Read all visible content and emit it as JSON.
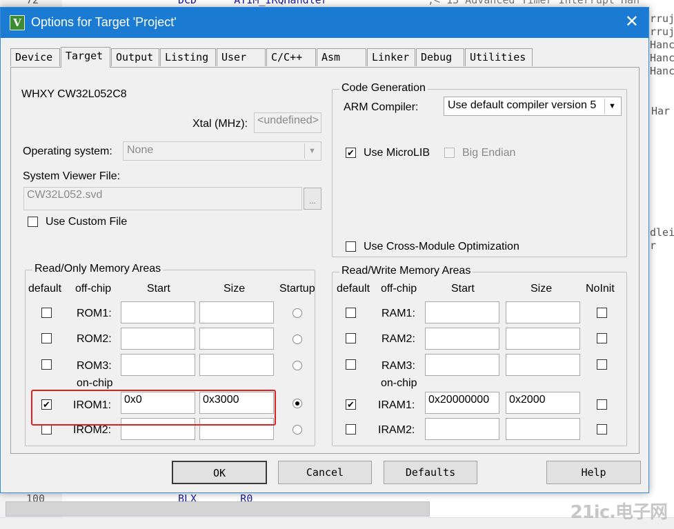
{
  "editor": {
    "top_line_num": "72",
    "top_line_code": "DCD      ATIM_IRQHandler",
    "top_line_comment": ";< 13 Advanced Timer Interrupt Han",
    "right_fragments": [
      "rruj",
      "rruj",
      "Hanc",
      "Hanc",
      "Hanc",
      "Har",
      "dlei",
      "r"
    ],
    "bottom_line_num": "100",
    "bottom_line_code": "BLX       R0",
    "watermark": "21ic.电子网"
  },
  "dialog": {
    "title": "Options for Target 'Project'",
    "icon_letter": "V",
    "close_glyph": "✕"
  },
  "tabs": [
    "Device",
    "Target",
    "Output",
    "Listing",
    "User",
    "C/C++",
    "Asm",
    "Linker",
    "Debug",
    "Utilities"
  ],
  "target": {
    "device_name": "WHXY CW32L052C8",
    "xtal_label": "Xtal (MHz):",
    "xtal_value": "<undefined>",
    "os_label": "Operating system:",
    "os_value": "None",
    "svd_label": "System Viewer File:",
    "svd_value": "CW32L052.svd",
    "svd_browse": "...",
    "custom_file_label": "Use Custom File",
    "custom_file_checked": false
  },
  "codegen": {
    "legend": "Code Generation",
    "compiler_label": "ARM Compiler:",
    "compiler_value": "Use default compiler version 5",
    "microlib_label": "Use MicroLIB",
    "microlib_checked": true,
    "big_endian_label": "Big Endian",
    "big_endian_checked": false,
    "cross_module_label": "Use Cross-Module Optimization",
    "cross_module_checked": false
  },
  "ro_memory": {
    "legend": "Read/Only Memory Areas",
    "headers": {
      "default": "default",
      "offchip": "off-chip",
      "start": "Start",
      "size": "Size",
      "startup": "Startup"
    },
    "onchip_label": "on-chip",
    "rows": [
      {
        "label": "ROM1:",
        "default": false,
        "start": "",
        "size": "",
        "startup": false
      },
      {
        "label": "ROM2:",
        "default": false,
        "start": "",
        "size": "",
        "startup": false
      },
      {
        "label": "ROM3:",
        "default": false,
        "start": "",
        "size": "",
        "startup": false
      },
      {
        "label": "IROM1:",
        "default": true,
        "start": "0x0",
        "size": "0x3000",
        "startup": true
      },
      {
        "label": "IROM2:",
        "default": false,
        "start": "",
        "size": "",
        "startup": false
      }
    ]
  },
  "rw_memory": {
    "legend": "Read/Write Memory Areas",
    "headers": {
      "default": "default",
      "offchip": "off-chip",
      "start": "Start",
      "size": "Size",
      "noinit": "NoInit"
    },
    "onchip_label": "on-chip",
    "rows": [
      {
        "label": "RAM1:",
        "default": false,
        "start": "",
        "size": "",
        "noinit": false
      },
      {
        "label": "RAM2:",
        "default": false,
        "start": "",
        "size": "",
        "noinit": false
      },
      {
        "label": "RAM3:",
        "default": false,
        "start": "",
        "size": "",
        "noinit": false
      },
      {
        "label": "IRAM1:",
        "default": true,
        "start": "0x20000000",
        "size": "0x2000",
        "noinit": false
      },
      {
        "label": "IRAM2:",
        "default": false,
        "start": "",
        "size": "",
        "noinit": false
      }
    ]
  },
  "buttons": {
    "ok": "OK",
    "cancel": "Cancel",
    "defaults": "Defaults",
    "help": "Help"
  },
  "colors": {
    "titlebar": "#1b7bd3",
    "highlight": "#e02020",
    "panel": "#f0f0f0"
  }
}
